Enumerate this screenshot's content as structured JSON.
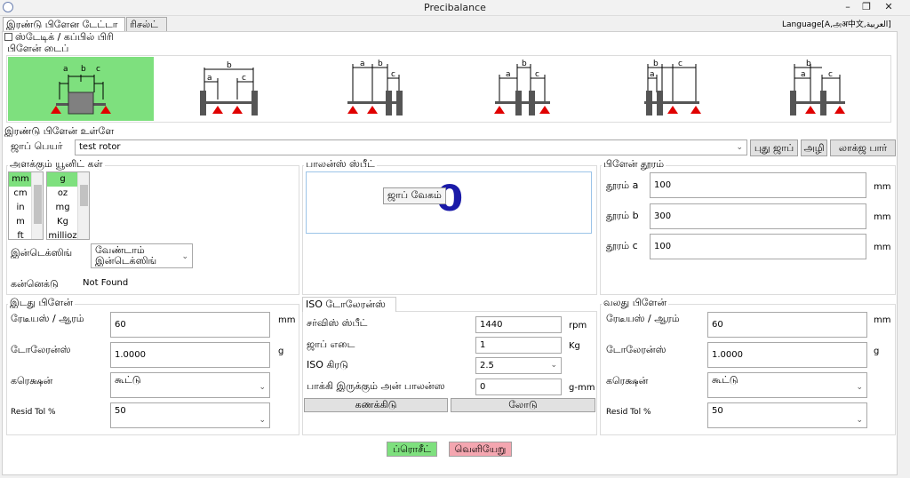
{
  "window": {
    "title": "Precibalance"
  },
  "tabs": [
    "இரண்டு பிளேன டேட்டா",
    "ரிசல்ட்"
  ],
  "language": "Language[A,அअ中文,العربية]",
  "static_couple": "ஸ்டேடிக் / கப்பில் பிரி",
  "plane_type": {
    "title": "பிளேன் டைப்",
    "dims": {
      "a": "a",
      "b": "b",
      "c": "c"
    }
  },
  "two_plane_input": "இரண்டு பிளேன் உள்ளே",
  "job": {
    "label": "ஜாப் பெயர்",
    "value": "test rotor",
    "new_job": "புது ஜாப்",
    "delete": "அழி",
    "logs": "லாக்ஜ பார்"
  },
  "units": {
    "title": "அளக்கும் யூனிட் கள்",
    "length": [
      "mm",
      "cm",
      "in",
      "m",
      "ft"
    ],
    "mass": [
      "g",
      "oz",
      "mg",
      "Kg",
      "millioz"
    ],
    "indexing_label": "இன்டெக்ஸிங்",
    "indexing_value": "வேண்டாம்\nஇன்டெக்ஸிங்",
    "connected_label": "கன்னெக்டு",
    "connected_value": "Not Found"
  },
  "balance_speed": {
    "title": "பாலன்ஸ் ஸ்பீட்",
    "job_speed": "ஜாப் வேகம்",
    "value": "0"
  },
  "plane_distance": {
    "title": "பிளேன் தூரம்",
    "rows": [
      {
        "label": "தூரம் a",
        "value": "100",
        "unit": "mm"
      },
      {
        "label": "தூரம் b",
        "value": "300",
        "unit": "mm"
      },
      {
        "label": "தூரம் c",
        "value": "100",
        "unit": "mm"
      }
    ]
  },
  "left_plane": {
    "title": "இடது பிளேன்",
    "radius_label": "ரேடீயஸ் / ஆரம்",
    "radius": "60",
    "radius_unit": "mm",
    "tol_label": "டோலேரன்ஸ்",
    "tol": "1.0000",
    "tol_unit": "g",
    "corr_label": "கரெக்ஷன்",
    "corr": "கூட்டு",
    "resid_label": "Resid Tol %",
    "resid": "50"
  },
  "iso": {
    "tab": "ISO டோலேரன்ஸ்",
    "speed_label": "சர்விஸ் ஸ்பீட்",
    "speed": "1440",
    "speed_unit": "rpm",
    "weight_label": "ஜாப் எடை",
    "weight": "1",
    "weight_unit": "Kg",
    "grade_label": "ISO கிரடு",
    "grade": "2.5",
    "residual_label": "பாக்கி இருக்கும் அன் பாலன்ஸ",
    "residual": "0",
    "residual_unit": "g-mm",
    "calc": "கணக்கிடு",
    "load": "லோடு"
  },
  "right_plane": {
    "title": "வலது பிளேன்",
    "radius_label": "ரேடீயஸ் / ஆரம்",
    "radius": "60",
    "radius_unit": "mm",
    "tol_label": "டோலேரன்ஸ்",
    "tol": "1.0000",
    "tol_unit": "g",
    "corr_label": "கரெக்ஷன்",
    "corr": "கூட்டு",
    "resid_label": "Resid Tol %",
    "resid": "50"
  },
  "footer": {
    "proceed": "ப்ரொசீட்",
    "exit": "வெளியேறு"
  },
  "colors": {
    "selected": "#7ee07e",
    "proceed": "#7ee07e",
    "exit": "#f4a6b0",
    "red": "#e00000",
    "dial": "#1a1aa8"
  }
}
